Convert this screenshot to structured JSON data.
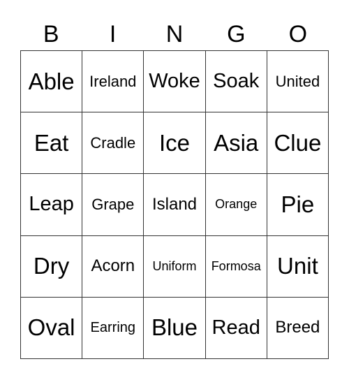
{
  "header": [
    "B",
    "I",
    "N",
    "G",
    "O"
  ],
  "rows": [
    [
      "Able",
      "Ireland",
      "Woke",
      "Soak",
      "United"
    ],
    [
      "Eat",
      "Cradle",
      "Ice",
      "Asia",
      "Clue"
    ],
    [
      "Leap",
      "Grape",
      "Island",
      "Orange",
      "Pie"
    ],
    [
      "Dry",
      "Acorn",
      "Uniform",
      "Formosa",
      "Unit"
    ],
    [
      "Oval",
      "Earring",
      "Blue",
      "Read",
      "Breed"
    ]
  ]
}
